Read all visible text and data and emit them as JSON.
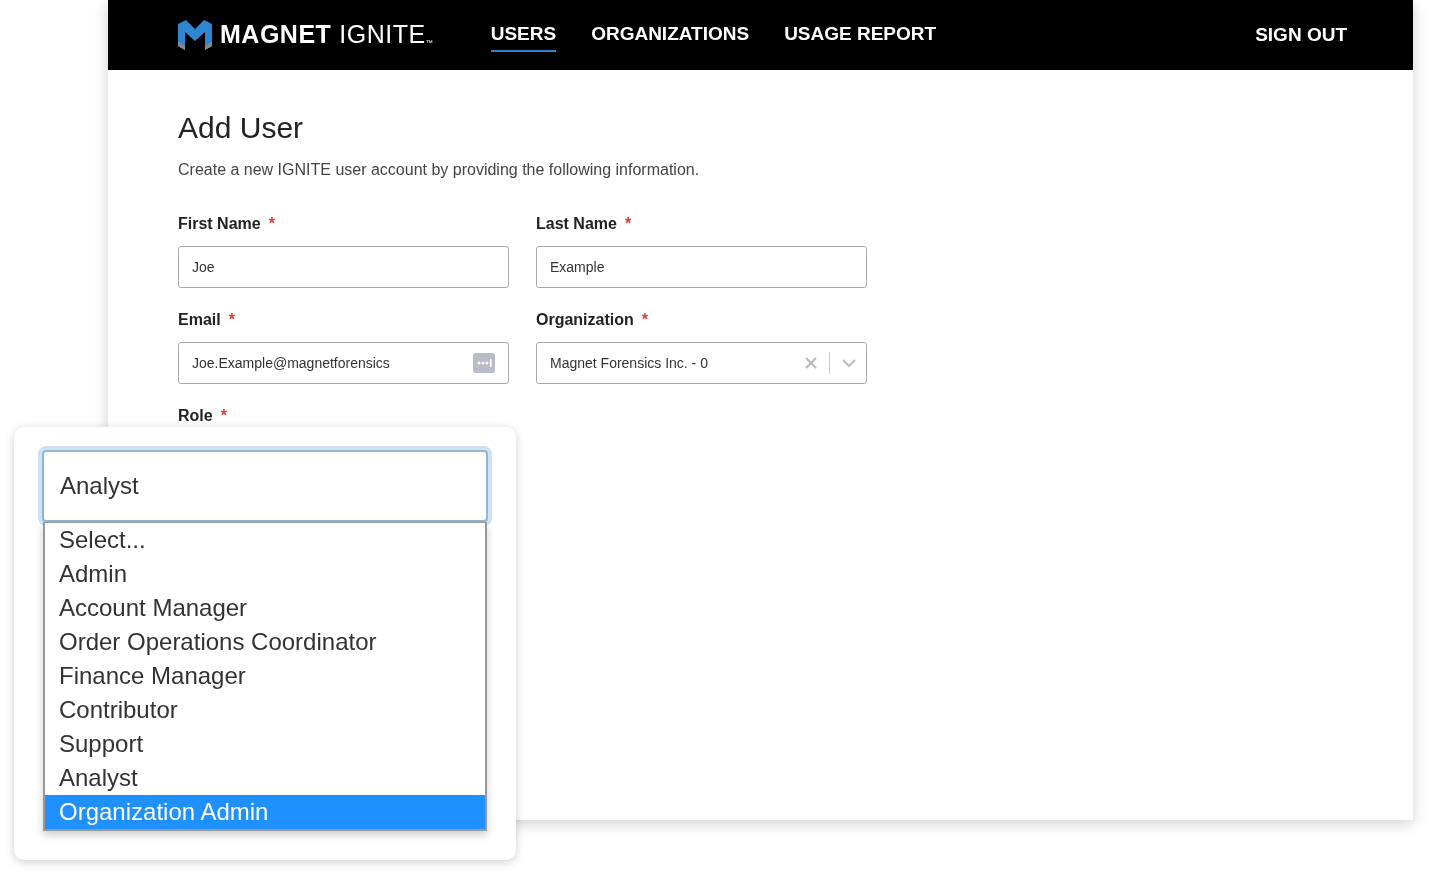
{
  "navbar": {
    "brand": {
      "name": "MAGNET",
      "product": "IGNITE",
      "mark": "™"
    },
    "links": [
      {
        "label": "USERS",
        "selected": true
      },
      {
        "label": "ORGANIZATIONS",
        "selected": false
      },
      {
        "label": "USAGE REPORT",
        "selected": false
      }
    ],
    "sign_out": "SIGN OUT"
  },
  "page": {
    "title": "Add User",
    "description": "Create a new IGNITE user account by providing the following information."
  },
  "form": {
    "fields": [
      {
        "label": "First Name",
        "required_mark": "*",
        "kind": "text",
        "value": "Joe"
      },
      {
        "label": "Last Name",
        "required_mark": "*",
        "kind": "text",
        "value": "Example"
      },
      {
        "label": "Email",
        "required_mark": "*",
        "kind": "email",
        "value": "Joe.Example@magnetforensics"
      },
      {
        "label": "Organization",
        "required_mark": "*",
        "kind": "select",
        "value": "Magnet Forensics Inc. - 0"
      },
      {
        "label": "Role",
        "required_mark": "*",
        "kind": "role"
      }
    ]
  },
  "role_dropdown": {
    "value": "Analyst",
    "options": [
      {
        "label": "Select...",
        "highlighted": false
      },
      {
        "label": "Admin",
        "highlighted": false
      },
      {
        "label": "Account Manager",
        "highlighted": false
      },
      {
        "label": "Order Operations Coordinator",
        "highlighted": false
      },
      {
        "label": "Finance Manager",
        "highlighted": false
      },
      {
        "label": "Contributor",
        "highlighted": false
      },
      {
        "label": "Support",
        "highlighted": false
      },
      {
        "label": "Analyst",
        "highlighted": false
      },
      {
        "label": "Organization Admin",
        "highlighted": true
      }
    ]
  }
}
